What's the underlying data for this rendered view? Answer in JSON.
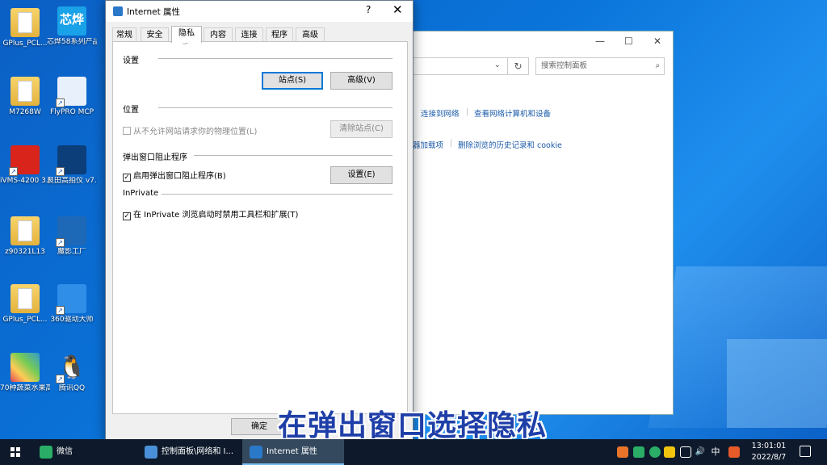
{
  "desktop": {
    "icons": [
      {
        "label": "GPlus_PCL..."
      },
      {
        "label": "芯烨58系列产品通用..."
      },
      {
        "label": "M7268W"
      },
      {
        "label": "FlyPRO MCP"
      },
      {
        "label": "iVMS-4200 3.8.0.4 各..."
      },
      {
        "label": "良田高拍仪 v7.0.3"
      },
      {
        "label": "z90321L13"
      },
      {
        "label": "魔影工厂"
      },
      {
        "label": "GPlus_PCL..."
      },
      {
        "label": "360驱动大师"
      },
      {
        "label": "70种蔬菜水果高清图片..."
      },
      {
        "label": "腾讯QQ"
      }
    ],
    "xin_glyph": "芯烨"
  },
  "control_panel": {
    "search_placeholder": "搜索控制面板",
    "links": [
      "连接到网络",
      "查看网络计算机和设备",
      "器加载项",
      "删除浏览的历史记录和 cookie"
    ]
  },
  "dialog": {
    "title": "Internet 属性",
    "help": "?",
    "close": "✕",
    "tabs": [
      "常规",
      "安全",
      "隐私",
      "内容",
      "连接",
      "程序",
      "高级"
    ],
    "active_tab": "隐私",
    "settings": {
      "heading": "设置",
      "sites_button": "站点(S)",
      "advanced_button": "高级(V)"
    },
    "location": {
      "heading": "位置",
      "checkbox_label": "从不允许网站请求你的物理位置(L)",
      "checked": false,
      "clear_button": "清除站点(C)"
    },
    "popup": {
      "heading": "弹出窗口阻止程序",
      "checkbox_label": "启用弹出窗口阻止程序(B)",
      "checked": true,
      "settings_button": "设置(E)"
    },
    "inprivate": {
      "heading": "InPrivate",
      "checkbox_label": "在 InPrivate 浏览启动时禁用工具栏和扩展(T)",
      "checked": true
    },
    "ok_button": "确定"
  },
  "subtitle": "在弹出窗口选择隐私",
  "taskbar": {
    "items": [
      {
        "label": "微信",
        "color": "#2aae67"
      },
      {
        "label": "控制面板\\网络和 I...",
        "color": "#4a90d9"
      },
      {
        "label": "Internet 属性",
        "color": "#2a78c8"
      }
    ],
    "ime": "中",
    "time": "13:01:01",
    "date": "2022/8/7"
  }
}
